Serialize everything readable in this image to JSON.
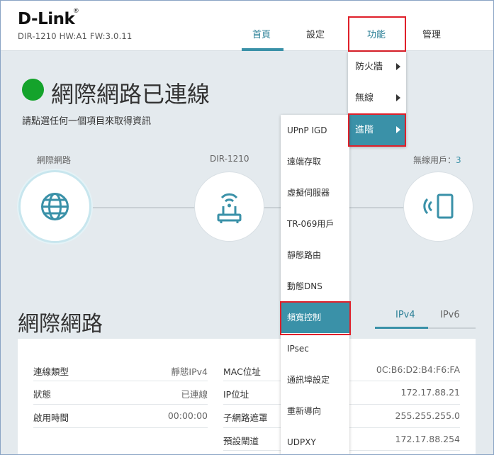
{
  "header": {
    "logo": "D-Link",
    "logo_mark": "®",
    "model_info": "DIR-1210 HW:A1 FW:3.0.11",
    "nav": {
      "home": "首頁",
      "settings": "設定",
      "features": "功能",
      "management": "管理"
    }
  },
  "status": {
    "title": "網際網路已連線",
    "subtitle": "請點選任何一個項目來取得資訊",
    "indicator_color": "#14a32b"
  },
  "diagram": {
    "internet_label": "網際網路",
    "router_label": "DIR-1210",
    "wireless_label": "無線用戶：",
    "wireless_count": "3",
    "internet_icon": "globe-icon",
    "router_icon": "router-icon",
    "wireless_icon": "tablet-wifi-icon"
  },
  "features_menu": {
    "items": [
      {
        "label": "防火牆",
        "has_submenu": true
      },
      {
        "label": "無線",
        "has_submenu": true
      },
      {
        "label": "進階",
        "has_submenu": true,
        "selected": true
      }
    ]
  },
  "advanced_submenu": {
    "items": [
      {
        "label": "UPnP IGD"
      },
      {
        "label": "遠端存取"
      },
      {
        "label": "虛擬伺服器"
      },
      {
        "label": "TR-069用戶"
      },
      {
        "label": "靜態路由"
      },
      {
        "label": "動態DNS"
      },
      {
        "label": "頻寬控制",
        "selected": true
      },
      {
        "label": "IPsec"
      },
      {
        "label": "通訊埠設定"
      },
      {
        "label": "重新導向"
      },
      {
        "label": "UDPXY"
      }
    ]
  },
  "internet_section": {
    "title": "網際網路",
    "tabs": [
      "IPv4",
      "IPv6"
    ],
    "active_tab": "IPv4",
    "left_rows": [
      {
        "label": "連線類型",
        "value": "靜態IPv4"
      },
      {
        "label": "狀態",
        "value": "已連線"
      },
      {
        "label": "啟用時間",
        "value": "00:00:00"
      }
    ],
    "right_rows": [
      {
        "label": "MAC位址",
        "value": "0C:B6:D2:B4:F6:FA"
      },
      {
        "label": "IP位址",
        "value": "172.17.88.21"
      },
      {
        "label": "子網路遮罩",
        "value": "255.255.255.0"
      },
      {
        "label": "預設閘道",
        "value": "172.17.88.254"
      }
    ]
  },
  "colors": {
    "accent": "#3a91a8",
    "highlight_box": "#e0202a",
    "connected": "#14a32b"
  }
}
